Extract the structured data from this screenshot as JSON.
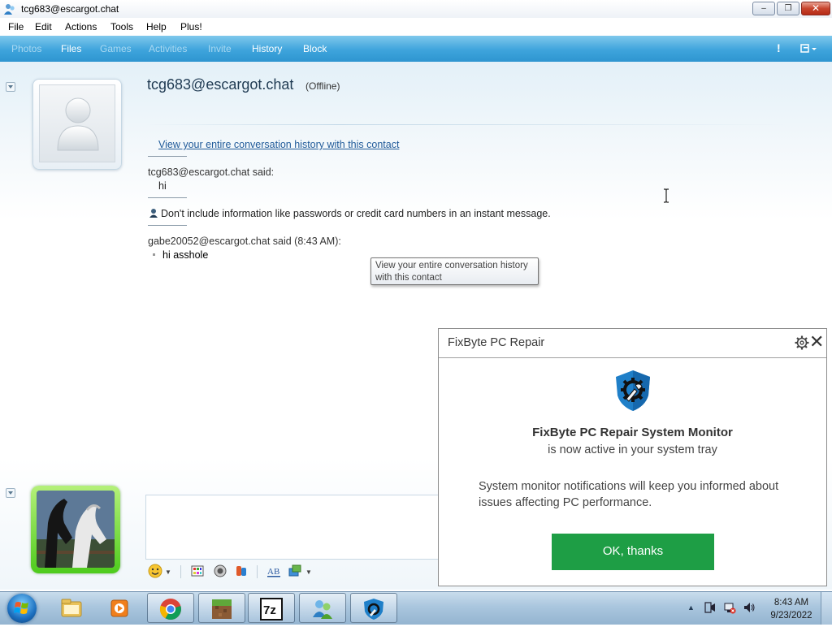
{
  "window": {
    "title": "tcg683@escargot.chat",
    "controls": {
      "minimize": "‒",
      "maximize": "❐",
      "close": "✕"
    }
  },
  "menu": [
    "File",
    "Edit",
    "Actions",
    "Tools",
    "Help",
    "Plus!"
  ],
  "toolbar": {
    "items": [
      {
        "label": "Photos",
        "enabled": false
      },
      {
        "label": "Files",
        "enabled": true
      },
      {
        "label": "Games",
        "enabled": false
      },
      {
        "label": "Activities",
        "enabled": false
      },
      {
        "label": "Invite",
        "enabled": false
      },
      {
        "label": "History",
        "enabled": true
      },
      {
        "label": "Block",
        "enabled": true
      }
    ],
    "alert": "!",
    "menu_icon": "window-menu-icon"
  },
  "contact": {
    "name": "tcg683@escargot.chat",
    "status": "(Offline)"
  },
  "conversation": {
    "history_link": "View your entire conversation history with this contact",
    "messages": [
      {
        "sender": "tcg683@escargot.chat said:",
        "text": "hi"
      },
      {
        "sender": "gabe20052@escargot.chat said (8:43 AM):",
        "text": "hi asshole"
      }
    ],
    "warning": "Don't include information like passwords or credit card numbers in an instant message."
  },
  "tooltip": {
    "line1": "View your entire conversation history",
    "line2": "with this contact"
  },
  "input": {
    "value": "",
    "tools": [
      "emoticon-icon",
      "wink-icon",
      "nudge-icon",
      "voice-clip-icon",
      "font-icon",
      "background-icon"
    ]
  },
  "popup": {
    "title": "FixByte PC Repair",
    "heading": "FixByte PC Repair System Monitor",
    "subheading": "is now active in your system tray",
    "body": "System monitor notifications will keep you informed about issues affecting PC performance.",
    "ok_button": "OK, thanks",
    "colors": {
      "button": "#1e9e45",
      "shield": "#1f7fc8"
    }
  },
  "taskbar": {
    "apps": [
      "explorer-icon",
      "media-player-icon",
      "chrome-icon",
      "minecraft-icon",
      "7zip-icon",
      "messenger-icon",
      "fixbyte-icon"
    ],
    "sevenzip_label": "7z",
    "clock": {
      "time": "8:43 AM",
      "date": "9/23/2022"
    }
  }
}
